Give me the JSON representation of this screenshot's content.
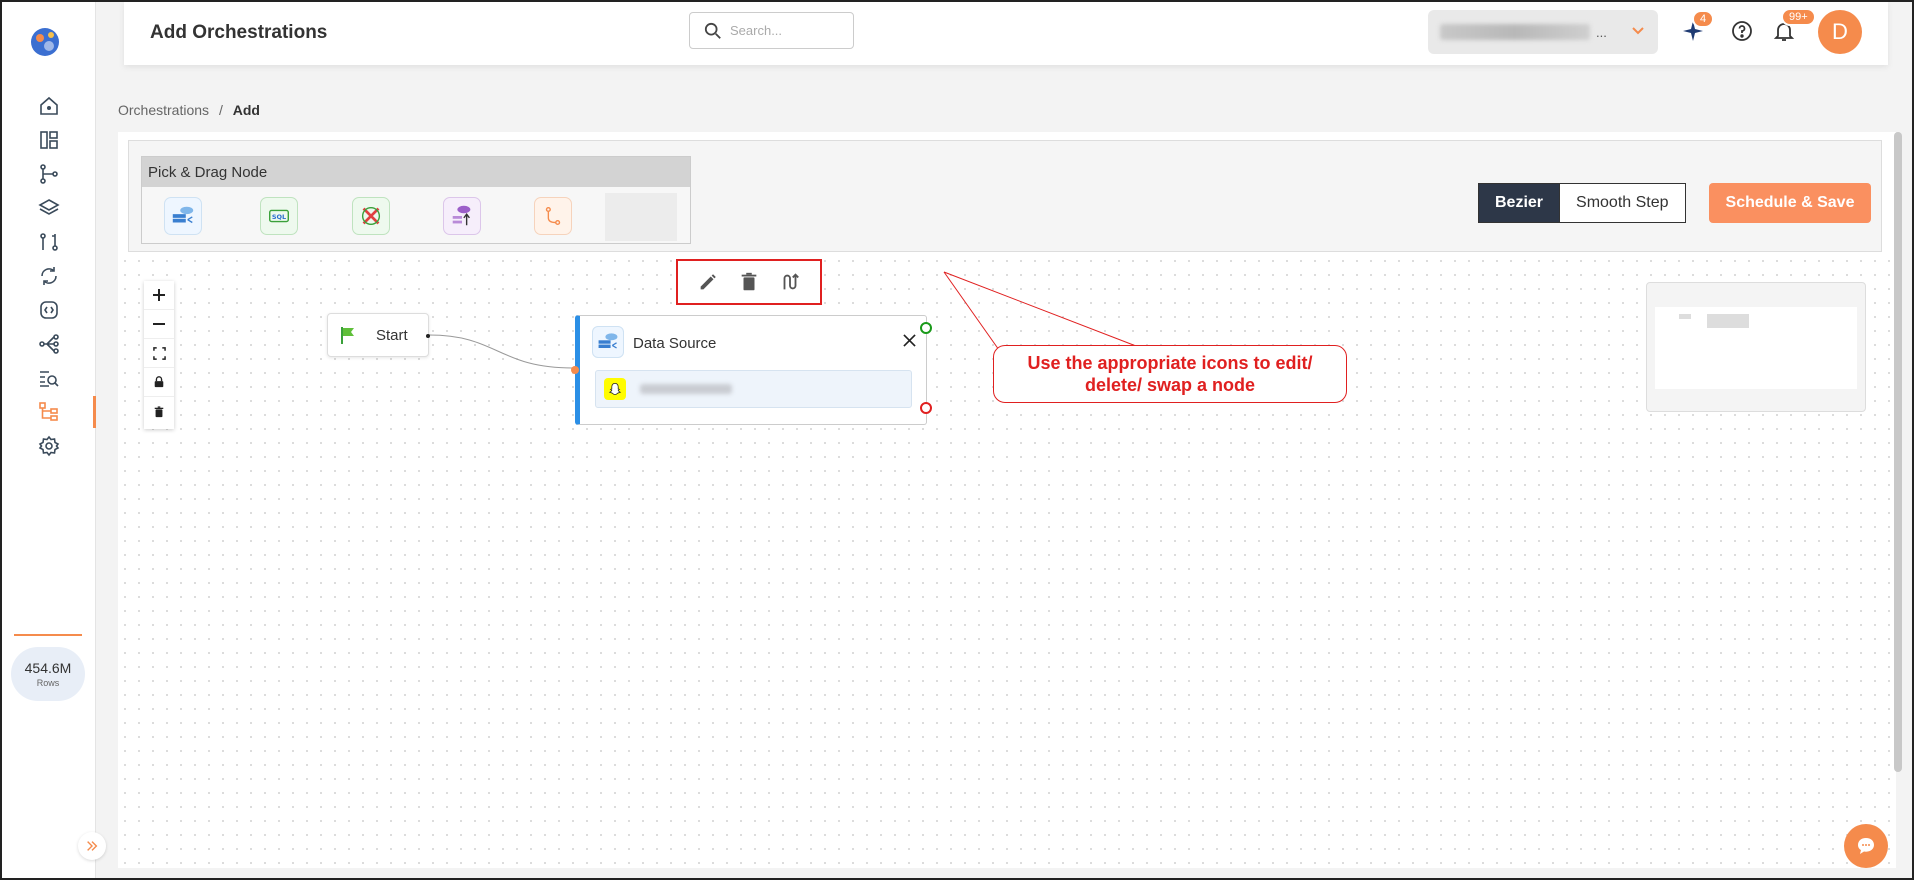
{
  "sidebar": {
    "items": [
      {
        "name": "home-icon"
      },
      {
        "name": "dashboard-icon"
      },
      {
        "name": "pipeline-icon"
      },
      {
        "name": "layers-icon"
      },
      {
        "name": "compare-icon"
      },
      {
        "name": "sync-icon"
      },
      {
        "name": "api-icon"
      },
      {
        "name": "flow-icon"
      },
      {
        "name": "query-search-icon"
      },
      {
        "name": "orchestration-icon",
        "active": true
      },
      {
        "name": "settings-icon"
      }
    ],
    "rows_value": "454.6M",
    "rows_label": "Rows"
  },
  "header": {
    "title": "Add Orchestrations",
    "search_placeholder": "Search...",
    "org_name": "...",
    "ai_badge": "4",
    "notif_badge": "99+",
    "avatar_initial": "D"
  },
  "breadcrumb": {
    "parent": "Orchestrations",
    "separator": "/",
    "current": "Add"
  },
  "palette": {
    "title": "Pick & Drag Node",
    "nodes": [
      "data-source-node-icon",
      "sql-node-icon",
      "transform-node-icon",
      "upload-node-icon",
      "branch-node-icon"
    ]
  },
  "edge_types": {
    "active": "Bezier",
    "inactive": "Smooth Step"
  },
  "schedule_button": "Schedule & Save",
  "start_node": {
    "label": "Start"
  },
  "data_source_node": {
    "title": "Data Source"
  },
  "callout": {
    "line1": "Use the appropriate icons to edit/",
    "line2": "delete/ swap a node"
  },
  "colors": {
    "accent": "#f58b4c",
    "annotation": "#e02020",
    "node_border": "#2b8fe6",
    "toggle_active": "#2d3748"
  }
}
